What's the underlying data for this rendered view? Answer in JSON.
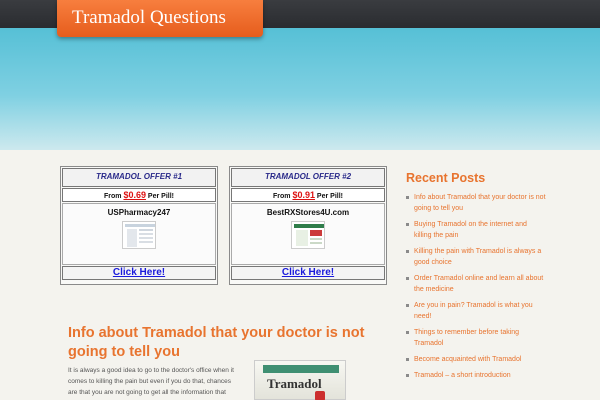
{
  "site": {
    "title": "Tramadol Questions"
  },
  "offers": [
    {
      "title": "TRAMADOL OFFER #1",
      "price_prefix": "From ",
      "price": "$0.69",
      "price_suffix": " Per Pill!",
      "store": "USPharmacy247",
      "cta": "Click Here!"
    },
    {
      "title": "TRAMADOL OFFER #2",
      "price_prefix": "From ",
      "price": "$0.91",
      "price_suffix": " Per Pill!",
      "store": "BestRXStores4U.com",
      "cta": "Click Here!"
    }
  ],
  "post": {
    "title": "Info about Tramadol that your doctor is not going to tell you",
    "excerpt": "It is always a good idea to go to the doctor's office when it comes to killing the pain but even if you do that, chances are that you are not going to get all the information that you have been looking for. The",
    "image_word": "Tramadol"
  },
  "sidebar": {
    "title": "Recent Posts",
    "items": [
      "Info about Tramadol that your doctor is not going to tell you",
      "Buying Tramadol on the internet and killing the pain",
      "Killing the pain with Tramadol is always a good choice",
      "Order Tramadol online and learn all about the medicine",
      "Are you in pain? Tramadol is what you need!",
      "Things to remember before taking Tramadol",
      "Become acquainted with Tramadol",
      "Tramadol – a short introduction"
    ]
  },
  "colors": {
    "accent": "#e8742f",
    "sky": "#56c0d6",
    "link": "#1a1adc"
  }
}
